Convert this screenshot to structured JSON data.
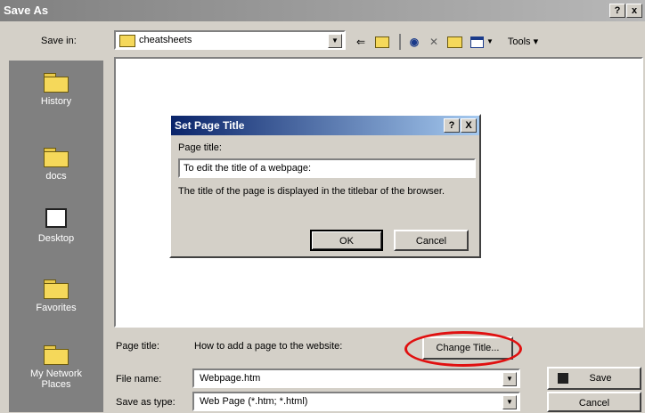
{
  "window": {
    "title": "Save As",
    "help": "?",
    "close": "x"
  },
  "toolbar": {
    "save_in_label": "Save in:",
    "folder": "cheatsheets",
    "icons": [
      "back-arrow-icon",
      "up-folder-icon",
      "search-web-icon",
      "delete-icon",
      "new-folder-icon",
      "views-icon"
    ],
    "tools_label": "Tools"
  },
  "places": [
    {
      "label": "History",
      "icon": "history-folder-icon"
    },
    {
      "label": "docs",
      "icon": "docs-folder-icon"
    },
    {
      "label": "Desktop",
      "icon": "desktop-icon"
    },
    {
      "label": "Favorites",
      "icon": "favorites-folder-icon"
    },
    {
      "label": "My Network Places",
      "icon": "network-places-icon"
    }
  ],
  "form": {
    "page_title_label": "Page title:",
    "page_title_value": "How to add a page to the website:",
    "change_title_button": "Change Title...",
    "file_name_label": "File name:",
    "file_name_value": "Webpage.htm",
    "save_type_label": "Save as type:",
    "save_type_value": "Web Page (*.htm; *.html)",
    "save_button": "Save",
    "cancel_button": "Cancel"
  },
  "dialog": {
    "title": "Set Page Title",
    "help": "?",
    "close": "X",
    "field_label": "Page title:",
    "field_value": "To edit the title of a webpage:",
    "description": "The title of the page is displayed in the titlebar of the browser.",
    "ok_button": "OK",
    "cancel_button": "Cancel"
  },
  "colors": {
    "dialog_title": "#0a246a",
    "annotation": "#e01010"
  }
}
